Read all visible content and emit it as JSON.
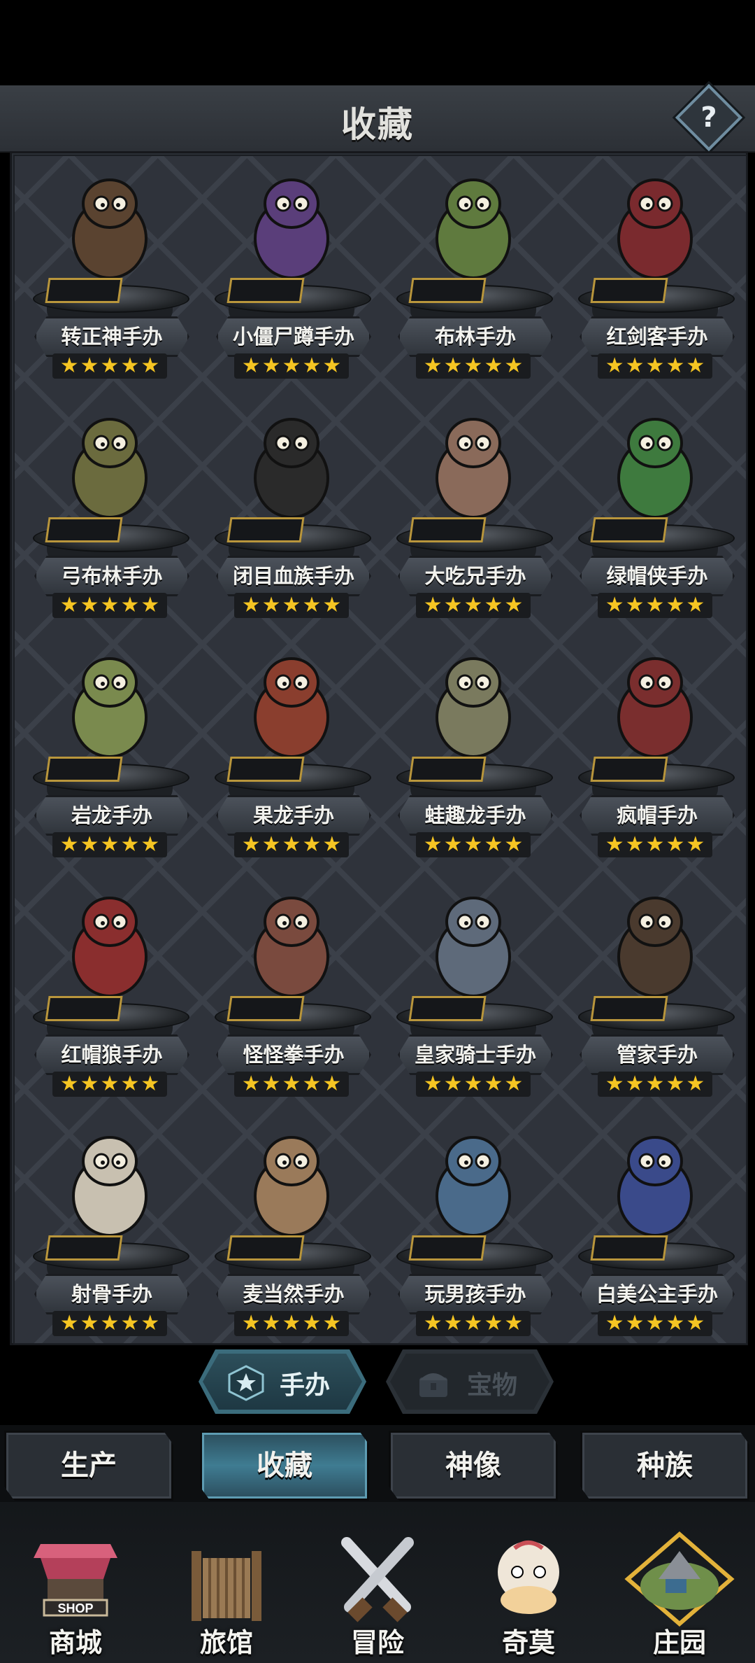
{
  "header": {
    "title": "收藏",
    "help_label": "?"
  },
  "figures": [
    {
      "name": "转正神手办",
      "stars": 5
    },
    {
      "name": "小僵尸蹲手办",
      "stars": 5
    },
    {
      "name": "布林手办",
      "stars": 5
    },
    {
      "name": "红剑客手办",
      "stars": 5
    },
    {
      "name": "弓布林手办",
      "stars": 5
    },
    {
      "name": "闭目血族手办",
      "stars": 5
    },
    {
      "name": "大吃兄手办",
      "stars": 5
    },
    {
      "name": "绿帽侠手办",
      "stars": 5
    },
    {
      "name": "岩龙手办",
      "stars": 5
    },
    {
      "name": "果龙手办",
      "stars": 5
    },
    {
      "name": "蛙趣龙手办",
      "stars": 5
    },
    {
      "name": "疯帽手办",
      "stars": 5
    },
    {
      "name": "红帽狼手办",
      "stars": 5
    },
    {
      "name": "怪怪拳手办",
      "stars": 5
    },
    {
      "name": "皇家骑士手办",
      "stars": 5
    },
    {
      "name": "管家手办",
      "stars": 5
    },
    {
      "name": "射骨手办",
      "stars": 5
    },
    {
      "name": "麦当然手办",
      "stars": 5
    },
    {
      "name": "玩男孩手办",
      "stars": 5
    },
    {
      "name": "白美公主手办",
      "stars": 5
    }
  ],
  "subtabs": {
    "figures": "手办",
    "treasures": "宝物"
  },
  "category_tabs": [
    "生产",
    "收藏",
    "神像",
    "种族"
  ],
  "category_active": "收藏",
  "bottom_nav": [
    "商城",
    "旅馆",
    "冒险",
    "奇莫",
    "庄园"
  ],
  "bottom_active": "庄园",
  "shop_sign": "SHOP",
  "colors": {
    "star": "#f5c523",
    "plaque_border": "#b9963c",
    "accent": "#3f7c92"
  }
}
